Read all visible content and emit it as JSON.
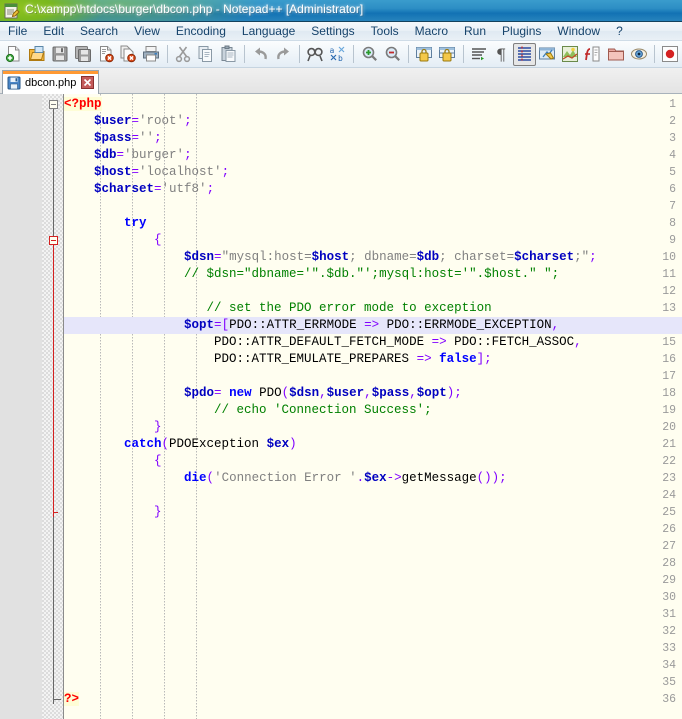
{
  "window": {
    "title": "C:\\xampp\\htdocs\\burger\\dbcon.php - Notepad++ [Administrator]",
    "icon": "notepad-plus-plus-icon"
  },
  "menubar": {
    "items": [
      {
        "label": "File"
      },
      {
        "label": "Edit"
      },
      {
        "label": "Search"
      },
      {
        "label": "View"
      },
      {
        "label": "Encoding"
      },
      {
        "label": "Language"
      },
      {
        "label": "Settings"
      },
      {
        "label": "Tools"
      },
      {
        "label": "Macro"
      },
      {
        "label": "Run"
      },
      {
        "label": "Plugins"
      },
      {
        "label": "Window"
      },
      {
        "label": "?"
      }
    ]
  },
  "toolbar": {
    "buttons": [
      {
        "name": "new-file-icon",
        "tip": "New"
      },
      {
        "name": "open-file-icon",
        "tip": "Open"
      },
      {
        "name": "save-icon",
        "tip": "Save"
      },
      {
        "name": "save-all-icon",
        "tip": "Save All"
      },
      {
        "name": "close-file-icon",
        "tip": "Close"
      },
      {
        "name": "close-all-icon",
        "tip": "Close All"
      },
      {
        "name": "print-icon",
        "tip": "Print"
      },
      {
        "name": "cut-icon",
        "tip": "Cut"
      },
      {
        "name": "copy-icon",
        "tip": "Copy"
      },
      {
        "name": "paste-icon",
        "tip": "Paste"
      },
      {
        "name": "undo-icon",
        "tip": "Undo"
      },
      {
        "name": "redo-icon",
        "tip": "Redo"
      },
      {
        "name": "find-icon",
        "tip": "Find"
      },
      {
        "name": "replace-icon",
        "tip": "Replace"
      },
      {
        "name": "zoom-in-icon",
        "tip": "Zoom In"
      },
      {
        "name": "zoom-out-icon",
        "tip": "Zoom Out"
      },
      {
        "name": "sync-vertical-icon",
        "tip": "Synchronize Vertical Scrolling"
      },
      {
        "name": "sync-horizontal-icon",
        "tip": "Synchronize Horizontal Scrolling"
      },
      {
        "name": "word-wrap-icon",
        "tip": "Word Wrap"
      },
      {
        "name": "show-all-chars-icon",
        "tip": "Show All Characters"
      },
      {
        "name": "indent-guide-icon",
        "tip": "Show Indent Guide"
      },
      {
        "name": "user-defined-dialog-icon",
        "tip": "User Defined Dialogue"
      },
      {
        "name": "document-map-icon",
        "tip": "Document Map"
      },
      {
        "name": "function-list-icon",
        "tip": "Function List"
      },
      {
        "name": "folder-workspace-icon",
        "tip": "Folder as Workspace"
      },
      {
        "name": "monitoring-icon",
        "tip": "Monitoring"
      },
      {
        "name": "record-macro-icon",
        "tip": "Start Recording"
      }
    ]
  },
  "tabs": [
    {
      "label": "dbcon.php",
      "icon": "saved-file-icon",
      "close": "close-tab-icon",
      "active": true
    }
  ],
  "editor": {
    "language": "PHP",
    "current_line": 14,
    "total_lines": 36,
    "lines": [
      {
        "n": 1,
        "tokens": [
          {
            "t": "tag",
            "s": "<?php"
          }
        ]
      },
      {
        "n": 2,
        "tokens": [
          {
            "t": "plain",
            "s": "    "
          },
          {
            "t": "var",
            "s": "$user"
          },
          {
            "t": "op",
            "s": "="
          },
          {
            "t": "str",
            "s": "'root'"
          },
          {
            "t": "punc",
            "s": ";"
          }
        ]
      },
      {
        "n": 3,
        "tokens": [
          {
            "t": "plain",
            "s": "    "
          },
          {
            "t": "var",
            "s": "$pass"
          },
          {
            "t": "op",
            "s": "="
          },
          {
            "t": "str",
            "s": "''"
          },
          {
            "t": "punc",
            "s": ";"
          }
        ]
      },
      {
        "n": 4,
        "tokens": [
          {
            "t": "plain",
            "s": "    "
          },
          {
            "t": "var",
            "s": "$db"
          },
          {
            "t": "op",
            "s": "="
          },
          {
            "t": "str",
            "s": "'burger'"
          },
          {
            "t": "punc",
            "s": ";"
          }
        ]
      },
      {
        "n": 5,
        "tokens": [
          {
            "t": "plain",
            "s": "    "
          },
          {
            "t": "var",
            "s": "$host"
          },
          {
            "t": "op",
            "s": "="
          },
          {
            "t": "str",
            "s": "'localhost'"
          },
          {
            "t": "punc",
            "s": ";"
          }
        ]
      },
      {
        "n": 6,
        "tokens": [
          {
            "t": "plain",
            "s": "    "
          },
          {
            "t": "var",
            "s": "$charset"
          },
          {
            "t": "op",
            "s": "="
          },
          {
            "t": "str",
            "s": "'utf8'"
          },
          {
            "t": "punc",
            "s": ";"
          }
        ]
      },
      {
        "n": 7,
        "tokens": []
      },
      {
        "n": 8,
        "tokens": [
          {
            "t": "plain",
            "s": "        "
          },
          {
            "t": "kw",
            "s": "try"
          }
        ]
      },
      {
        "n": 9,
        "tokens": [
          {
            "t": "plain",
            "s": "            "
          },
          {
            "t": "punc",
            "s": "{"
          }
        ]
      },
      {
        "n": 10,
        "tokens": [
          {
            "t": "plain",
            "s": "                "
          },
          {
            "t": "var",
            "s": "$dsn"
          },
          {
            "t": "op",
            "s": "="
          },
          {
            "t": "str",
            "s": "\"mysql:host="
          },
          {
            "t": "var",
            "s": "$host"
          },
          {
            "t": "str",
            "s": "; dbname="
          },
          {
            "t": "var",
            "s": "$db"
          },
          {
            "t": "str",
            "s": "; charset="
          },
          {
            "t": "var",
            "s": "$charset"
          },
          {
            "t": "str",
            "s": ";\""
          },
          {
            "t": "punc",
            "s": ";"
          }
        ]
      },
      {
        "n": 11,
        "tokens": [
          {
            "t": "plain",
            "s": "                "
          },
          {
            "t": "com",
            "s": "// $dsn=\"dbname='\".$db.\"';mysql:host='\".$host.\" \";"
          }
        ]
      },
      {
        "n": 12,
        "tokens": []
      },
      {
        "n": 13,
        "tokens": [
          {
            "t": "plain",
            "s": "                   "
          },
          {
            "t": "com",
            "s": "// set the PDO error mode to exception"
          }
        ]
      },
      {
        "n": 14,
        "tokens": [
          {
            "t": "plain",
            "s": "                "
          },
          {
            "t": "var",
            "s": "$opt"
          },
          {
            "t": "op",
            "s": "="
          },
          {
            "t": "punc",
            "s": "["
          },
          {
            "t": "def",
            "s": "PDO::ATTR_ERRMODE "
          },
          {
            "t": "op",
            "s": "=>"
          },
          {
            "t": "def",
            "s": " PDO::ERRMODE_EXCEPTION"
          },
          {
            "t": "punc",
            "s": ","
          }
        ]
      },
      {
        "n": 15,
        "tokens": [
          {
            "t": "plain",
            "s": "                    "
          },
          {
            "t": "def",
            "s": "PDO::ATTR_DEFAULT_FETCH_MODE "
          },
          {
            "t": "op",
            "s": "=>"
          },
          {
            "t": "def",
            "s": " PDO::FETCH_ASSOC"
          },
          {
            "t": "punc",
            "s": ","
          }
        ]
      },
      {
        "n": 16,
        "tokens": [
          {
            "t": "plain",
            "s": "                    "
          },
          {
            "t": "def",
            "s": "PDO::ATTR_EMULATE_PREPARES "
          },
          {
            "t": "op",
            "s": "=>"
          },
          {
            "t": "plain",
            "s": " "
          },
          {
            "t": "kw",
            "s": "false"
          },
          {
            "t": "punc",
            "s": "];"
          }
        ]
      },
      {
        "n": 17,
        "tokens": []
      },
      {
        "n": 18,
        "tokens": [
          {
            "t": "plain",
            "s": "                "
          },
          {
            "t": "var",
            "s": "$pdo"
          },
          {
            "t": "op",
            "s": "="
          },
          {
            "t": "plain",
            "s": " "
          },
          {
            "t": "kw",
            "s": "new"
          },
          {
            "t": "def",
            "s": " PDO"
          },
          {
            "t": "punc",
            "s": "("
          },
          {
            "t": "var",
            "s": "$dsn"
          },
          {
            "t": "punc",
            "s": ","
          },
          {
            "t": "var",
            "s": "$user"
          },
          {
            "t": "punc",
            "s": ","
          },
          {
            "t": "var",
            "s": "$pass"
          },
          {
            "t": "punc",
            "s": ","
          },
          {
            "t": "var",
            "s": "$opt"
          },
          {
            "t": "punc",
            "s": ");"
          }
        ]
      },
      {
        "n": 19,
        "tokens": [
          {
            "t": "plain",
            "s": "                    "
          },
          {
            "t": "com",
            "s": "// echo 'Connection Success';"
          }
        ]
      },
      {
        "n": 20,
        "tokens": [
          {
            "t": "plain",
            "s": "            "
          },
          {
            "t": "punc",
            "s": "}"
          }
        ]
      },
      {
        "n": 21,
        "tokens": [
          {
            "t": "plain",
            "s": "        "
          },
          {
            "t": "kw",
            "s": "catch"
          },
          {
            "t": "punc",
            "s": "("
          },
          {
            "t": "def",
            "s": "PDOException "
          },
          {
            "t": "var",
            "s": "$ex"
          },
          {
            "t": "punc",
            "s": ")"
          }
        ]
      },
      {
        "n": 22,
        "tokens": [
          {
            "t": "plain",
            "s": "            "
          },
          {
            "t": "punc",
            "s": "{"
          }
        ]
      },
      {
        "n": 23,
        "tokens": [
          {
            "t": "plain",
            "s": "                "
          },
          {
            "t": "kw",
            "s": "die"
          },
          {
            "t": "punc",
            "s": "("
          },
          {
            "t": "str",
            "s": "'Connection Error '"
          },
          {
            "t": "punc",
            "s": "."
          },
          {
            "t": "var",
            "s": "$ex"
          },
          {
            "t": "op",
            "s": "->"
          },
          {
            "t": "def",
            "s": "getMessage"
          },
          {
            "t": "punc",
            "s": "());"
          }
        ]
      },
      {
        "n": 24,
        "tokens": []
      },
      {
        "n": 25,
        "tokens": [
          {
            "t": "plain",
            "s": "            "
          },
          {
            "t": "punc",
            "s": "}"
          }
        ]
      },
      {
        "n": 26,
        "tokens": []
      },
      {
        "n": 27,
        "tokens": []
      },
      {
        "n": 28,
        "tokens": []
      },
      {
        "n": 29,
        "tokens": []
      },
      {
        "n": 30,
        "tokens": []
      },
      {
        "n": 31,
        "tokens": []
      },
      {
        "n": 32,
        "tokens": []
      },
      {
        "n": 33,
        "tokens": []
      },
      {
        "n": 34,
        "tokens": []
      },
      {
        "n": 35,
        "tokens": []
      },
      {
        "n": 36,
        "tokens": [
          {
            "t": "tag",
            "s": "?>"
          }
        ]
      }
    ],
    "fold_points": [
      {
        "line": 1,
        "state": "collapsible",
        "color": "grey"
      },
      {
        "line": 9,
        "state": "collapsible",
        "color": "red"
      }
    ]
  },
  "colors": {
    "editor_background": "#FFFEF0",
    "gutter_background": "#E1E1E1",
    "current_line": "#E6E6FA",
    "keyword": "#0000FF",
    "variable": "#0000C0",
    "string": "#808080",
    "comment": "#008000",
    "operator": "#8000FF",
    "tag": "#FF0000",
    "tab_accent": "#FF9933",
    "titlebar_blue": "#1272B4",
    "titlebar_green": "#7AB81E"
  }
}
